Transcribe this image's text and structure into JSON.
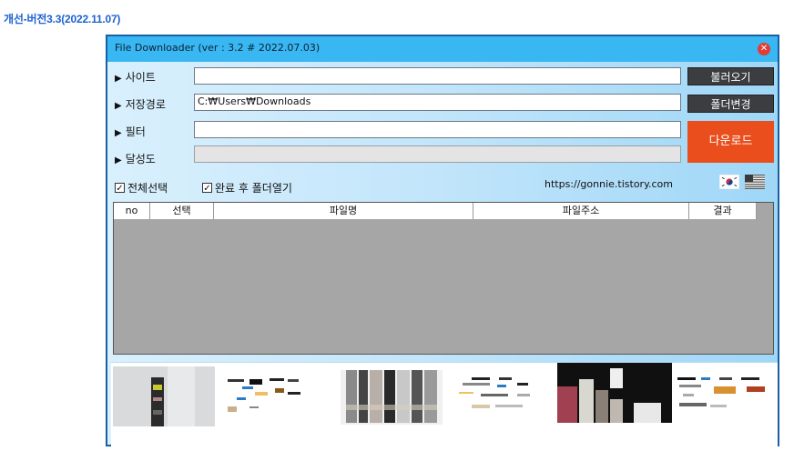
{
  "caption": "개선-버전3.3(2022.11.07)",
  "window": {
    "title": "File Downloader (ver : 3.2 # 2022.07.03)",
    "close_icon": "close-icon"
  },
  "form": {
    "site_label": "사이트",
    "site_value": "",
    "path_label": "저장경로",
    "path_value": "C:₩Users₩Downloads",
    "filter_label": "필터",
    "filter_value": "",
    "progress_label": "달성도",
    "progress_value": 0,
    "load_button": "불러오기",
    "change_folder_button": "폴더변경",
    "download_button": "다운로드"
  },
  "options": {
    "select_all_label": "전체선택",
    "select_all_checked": true,
    "open_folder_label": "완료 후 폴더열기",
    "open_folder_checked": true
  },
  "link": "https://gonnie.tistory.com",
  "languages": [
    "korean-flag-icon",
    "us-flag-icon"
  ],
  "table": {
    "columns": [
      "no",
      "선택",
      "파일명",
      "파일주소",
      "결과"
    ],
    "rows": []
  },
  "colors": {
    "titlebar": "#39b7f2",
    "download": "#e94e1c",
    "dark_button": "#3c3d40",
    "caption": "#1e62d0"
  }
}
